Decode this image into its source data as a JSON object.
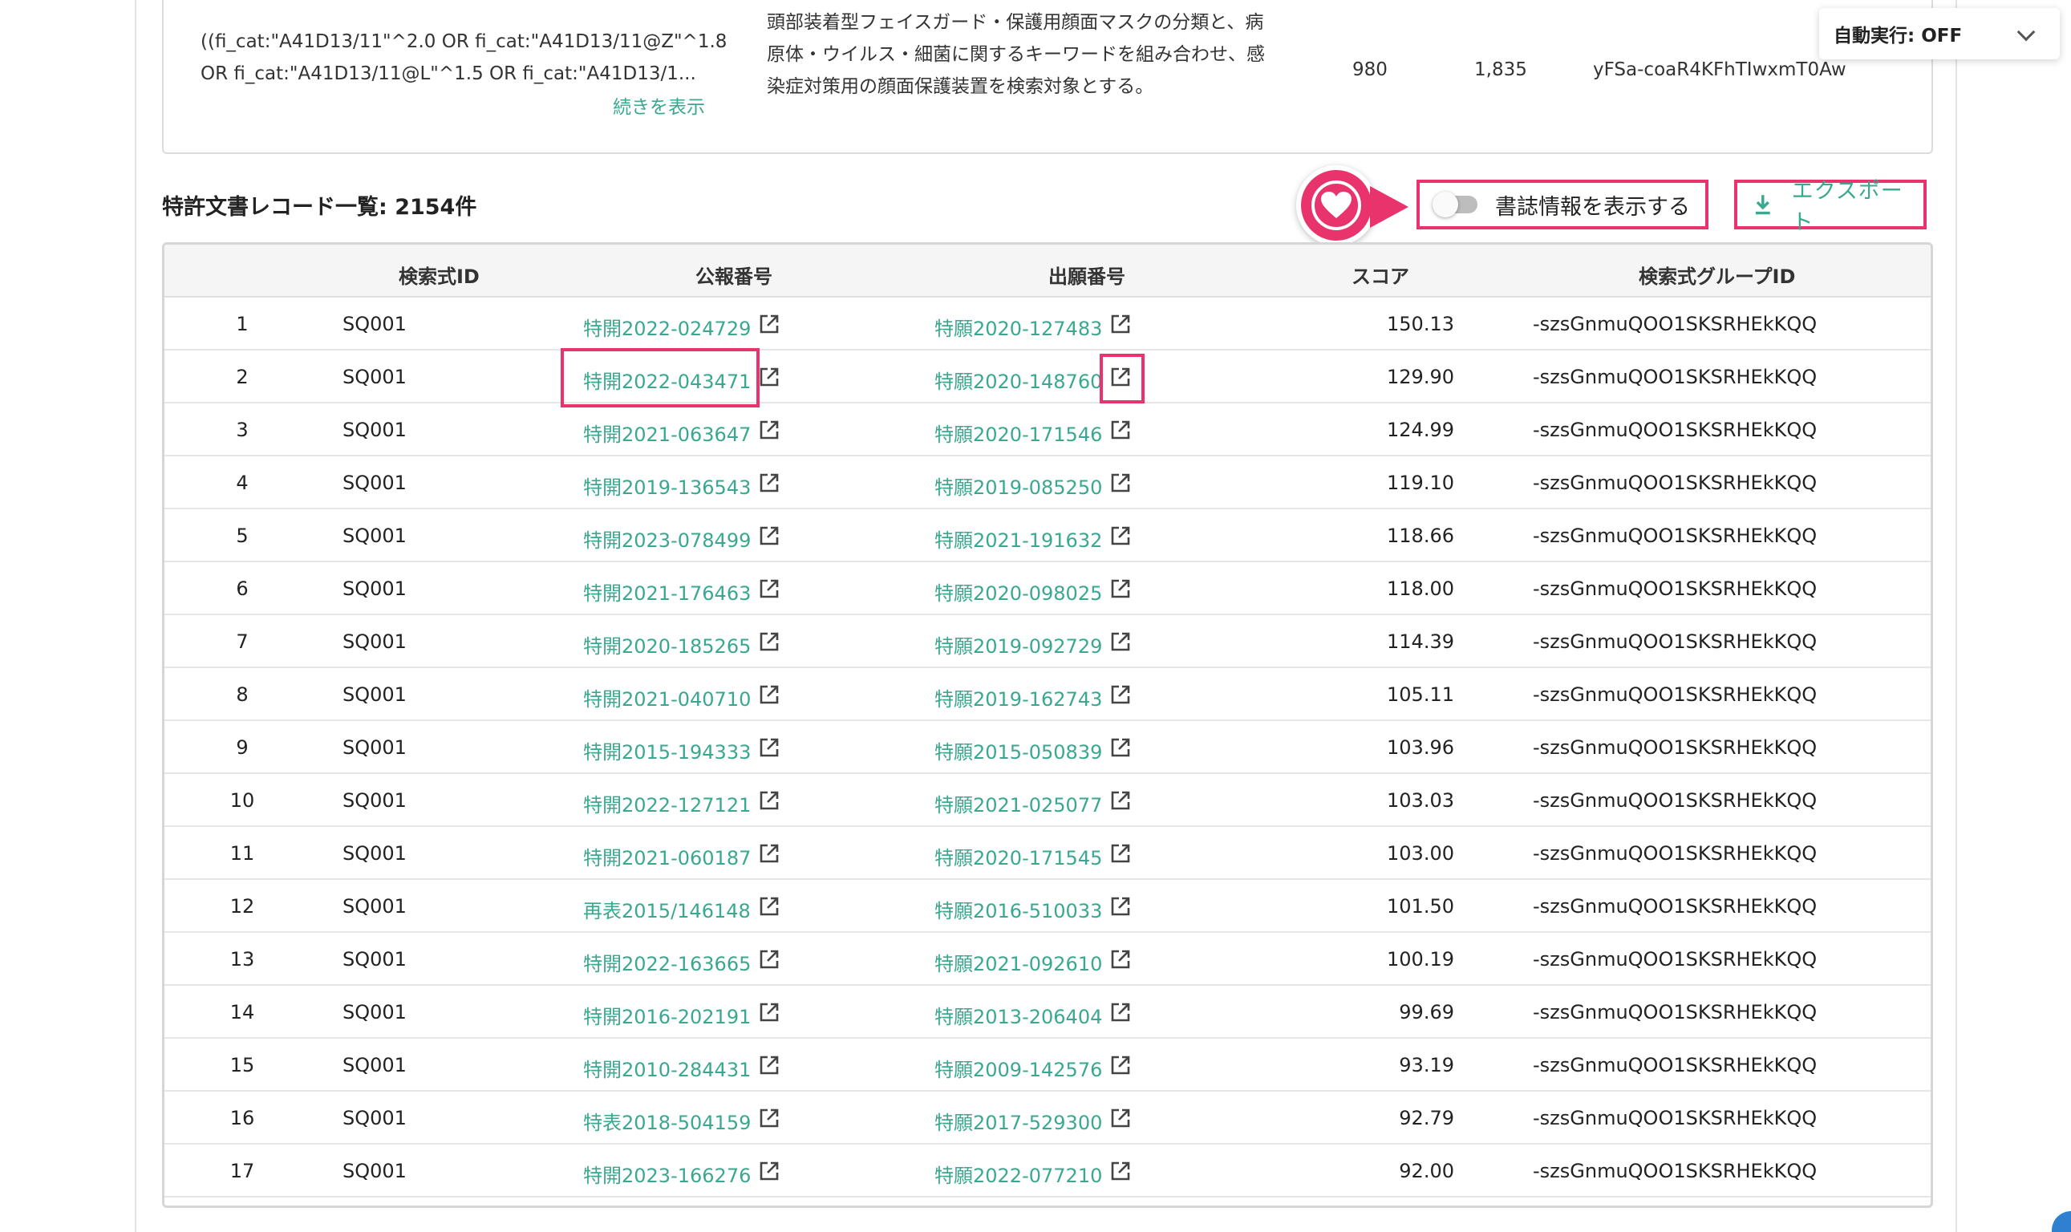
{
  "query_row": {
    "formula": "((fi_cat:\"A41D13/11\"^2.0 OR fi_cat:\"A41D13/11@Z\"^1.8 OR fi_cat:\"A41D13/11@L\"^1.5 OR fi_cat:\"A41D13/1...",
    "show_more": "続きを表示",
    "description": "頭部装着型フェイスガード・保護用顔面マスクの分類と、病原体・ウイルス・細菌に関するキーワードを組み合わせ、感染症対策用の顔面保護装置を検索対象とする。",
    "count1": "980",
    "count2": "1,835",
    "id": "yFSa-coaR4KFhTIwxmT0Aw"
  },
  "auto_run": {
    "label": "自動実行: OFF"
  },
  "records": {
    "title": "特許文書レコード一覧: 2154件",
    "toggle_label": "書誌情報を表示する",
    "toggle_on": false,
    "export_label": "エクスポート"
  },
  "colors": {
    "accent": "#3aa890",
    "highlight": "#e8336d"
  },
  "table": {
    "headers": {
      "query_id": "検索式ID",
      "publication": "公報番号",
      "application": "出願番号",
      "score": "スコア",
      "group_id": "検索式グループID"
    },
    "rows": [
      {
        "n": "1",
        "qid": "SQ001",
        "pub": "特開2022-024729",
        "app": "特願2020-127483",
        "score": "150.13",
        "gid": "-szsGnmuQOO1SKSRHEkKQQ"
      },
      {
        "n": "2",
        "qid": "SQ001",
        "pub": "特開2022-043471",
        "app": "特願2020-148760",
        "score": "129.90",
        "gid": "-szsGnmuQOO1SKSRHEkKQQ"
      },
      {
        "n": "3",
        "qid": "SQ001",
        "pub": "特開2021-063647",
        "app": "特願2020-171546",
        "score": "124.99",
        "gid": "-szsGnmuQOO1SKSRHEkKQQ"
      },
      {
        "n": "4",
        "qid": "SQ001",
        "pub": "特開2019-136543",
        "app": "特願2019-085250",
        "score": "119.10",
        "gid": "-szsGnmuQOO1SKSRHEkKQQ"
      },
      {
        "n": "5",
        "qid": "SQ001",
        "pub": "特開2023-078499",
        "app": "特願2021-191632",
        "score": "118.66",
        "gid": "-szsGnmuQOO1SKSRHEkKQQ"
      },
      {
        "n": "6",
        "qid": "SQ001",
        "pub": "特開2021-176463",
        "app": "特願2020-098025",
        "score": "118.00",
        "gid": "-szsGnmuQOO1SKSRHEkKQQ"
      },
      {
        "n": "7",
        "qid": "SQ001",
        "pub": "特開2020-185265",
        "app": "特願2019-092729",
        "score": "114.39",
        "gid": "-szsGnmuQOO1SKSRHEkKQQ"
      },
      {
        "n": "8",
        "qid": "SQ001",
        "pub": "特開2021-040710",
        "app": "特願2019-162743",
        "score": "105.11",
        "gid": "-szsGnmuQOO1SKSRHEkKQQ"
      },
      {
        "n": "9",
        "qid": "SQ001",
        "pub": "特開2015-194333",
        "app": "特願2015-050839",
        "score": "103.96",
        "gid": "-szsGnmuQOO1SKSRHEkKQQ"
      },
      {
        "n": "10",
        "qid": "SQ001",
        "pub": "特開2022-127121",
        "app": "特願2021-025077",
        "score": "103.03",
        "gid": "-szsGnmuQOO1SKSRHEkKQQ"
      },
      {
        "n": "11",
        "qid": "SQ001",
        "pub": "特開2021-060187",
        "app": "特願2020-171545",
        "score": "103.00",
        "gid": "-szsGnmuQOO1SKSRHEkKQQ"
      },
      {
        "n": "12",
        "qid": "SQ001",
        "pub": "再表2015/146148",
        "app": "特願2016-510033",
        "score": "101.50",
        "gid": "-szsGnmuQOO1SKSRHEkKQQ"
      },
      {
        "n": "13",
        "qid": "SQ001",
        "pub": "特開2022-163665",
        "app": "特願2021-092610",
        "score": "100.19",
        "gid": "-szsGnmuQOO1SKSRHEkKQQ"
      },
      {
        "n": "14",
        "qid": "SQ001",
        "pub": "特開2016-202191",
        "app": "特願2013-206404",
        "score": "99.69",
        "gid": "-szsGnmuQOO1SKSRHEkKQQ"
      },
      {
        "n": "15",
        "qid": "SQ001",
        "pub": "特開2010-284431",
        "app": "特願2009-142576",
        "score": "93.19",
        "gid": "-szsGnmuQOO1SKSRHEkKQQ"
      },
      {
        "n": "16",
        "qid": "SQ001",
        "pub": "特表2018-504159",
        "app": "特願2017-529300",
        "score": "92.79",
        "gid": "-szsGnmuQOO1SKSRHEkKQQ"
      },
      {
        "n": "17",
        "qid": "SQ001",
        "pub": "特開2023-166276",
        "app": "特願2022-077210",
        "score": "92.00",
        "gid": "-szsGnmuQOO1SKSRHEkKQQ"
      }
    ]
  }
}
